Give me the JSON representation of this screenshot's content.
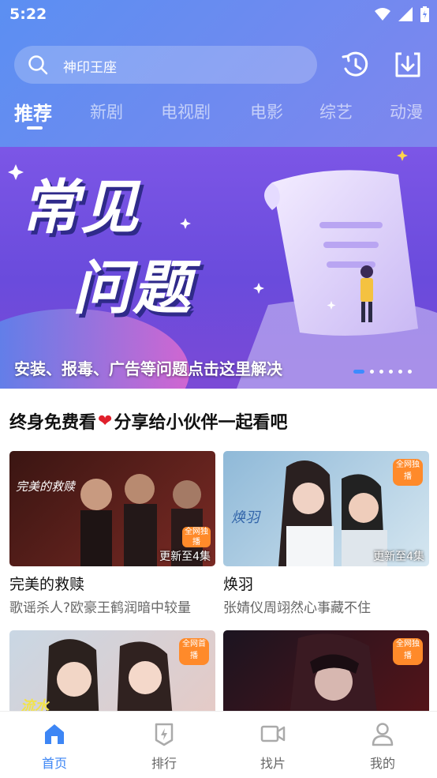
{
  "status": {
    "time": "5:22"
  },
  "search": {
    "text": "神印王座"
  },
  "tabs": [
    {
      "label": "推荐",
      "active": true
    },
    {
      "label": "新剧"
    },
    {
      "label": "电视剧"
    },
    {
      "label": "电影"
    },
    {
      "label": "综艺"
    },
    {
      "label": "动漫"
    }
  ],
  "banner": {
    "headline_line1": "常见",
    "headline_line2": "问题",
    "caption": "安装、报毒、广告等问题点击这里解决",
    "page_count": 6,
    "active_index": 0
  },
  "section": {
    "title_part1": "终身免费看",
    "title_part2": "分享给小伙伴一起看吧"
  },
  "cards": [
    {
      "title": "完美的救赎",
      "subtitle": "歌谣杀人?欧豪王鹤润暗中较量",
      "badge": "更新至4集",
      "poster_text": "完美的救赎",
      "corner": "全网独播",
      "colors": [
        "#3a1512",
        "#7a2a24"
      ]
    },
    {
      "title": "焕羽",
      "subtitle": "张婧仪周翊然心事藏不住",
      "badge": "更新至4集",
      "poster_text": "焕羽",
      "corner": "全网独播",
      "colors": [
        "#8fb9d8",
        "#d5e6f0"
      ]
    },
    {
      "title": "",
      "subtitle": "",
      "badge": "",
      "poster_text": "流水",
      "corner": "全网首播",
      "colors": [
        "#c9d7e4",
        "#e8c9c3"
      ]
    },
    {
      "title": "",
      "subtitle": "",
      "badge": "",
      "poster_text": "",
      "corner": "全网独播",
      "colors": [
        "#1b1420",
        "#5a1418"
      ]
    }
  ],
  "nav": [
    {
      "label": "首页",
      "icon": "home-icon",
      "active": true
    },
    {
      "label": "排行",
      "icon": "rank-icon"
    },
    {
      "label": "找片",
      "icon": "video-camera-icon"
    },
    {
      "label": "我的",
      "icon": "user-icon"
    }
  ],
  "colors": {
    "accent": "#3d86f5",
    "header": "#6b8bf0",
    "banner": "#6a4bdc",
    "heart": "#e0202c"
  }
}
